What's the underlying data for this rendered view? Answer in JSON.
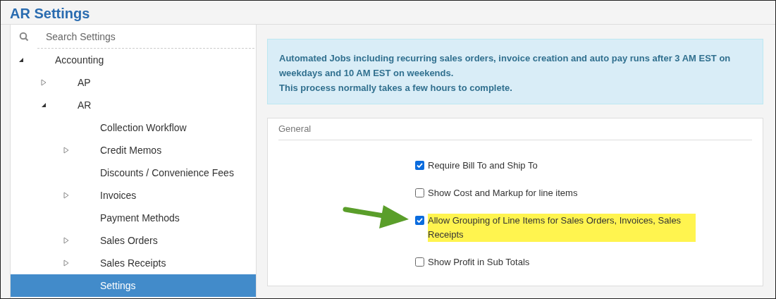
{
  "window": {
    "title": "AR Settings"
  },
  "sidebar": {
    "search": {
      "placeholder": "Search Settings"
    },
    "tree": [
      {
        "label": "Accounting",
        "kind": "branch",
        "expanded": true,
        "selected": false,
        "children": [
          {
            "label": "AP",
            "kind": "branch",
            "expanded": false,
            "selected": false
          },
          {
            "label": "AR",
            "kind": "branch",
            "expanded": true,
            "selected": false,
            "children": [
              {
                "label": "Collection Workflow",
                "kind": "leaf",
                "selected": false
              },
              {
                "label": "Credit Memos",
                "kind": "branch",
                "expanded": false,
                "selected": false
              },
              {
                "label": "Discounts / Convenience Fees",
                "kind": "leaf",
                "selected": false
              },
              {
                "label": "Invoices",
                "kind": "branch",
                "expanded": false,
                "selected": false
              },
              {
                "label": "Payment Methods",
                "kind": "leaf",
                "selected": false
              },
              {
                "label": "Sales Orders",
                "kind": "branch",
                "expanded": false,
                "selected": false
              },
              {
                "label": "Sales Receipts",
                "kind": "branch",
                "expanded": false,
                "selected": false
              },
              {
                "label": "Settings",
                "kind": "leaf",
                "selected": true
              }
            ]
          }
        ]
      }
    ]
  },
  "notice": {
    "lines": [
      "Automated Jobs including recurring sales orders, invoice creation and auto pay runs after 3 AM EST on weekdays and 10 AM EST on weekends.",
      "This process normally takes a few hours to complete."
    ]
  },
  "general": {
    "title": "General",
    "options": [
      {
        "label": "Require Bill To and Ship To",
        "checked": true,
        "highlighted": false
      },
      {
        "label": "Show Cost and Markup for line items",
        "checked": false,
        "highlighted": false
      },
      {
        "label": "Allow Grouping of Line Items for Sales Orders, Invoices, Sales Receipts",
        "checked": true,
        "highlighted": true
      },
      {
        "label": "Show Profit in Sub Totals",
        "checked": false,
        "highlighted": false
      }
    ]
  }
}
